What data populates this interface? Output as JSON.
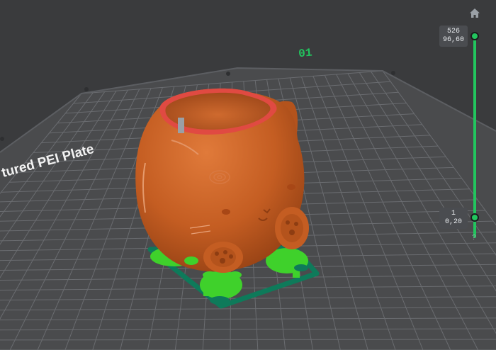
{
  "viewport": {
    "plate_label": "tured PEI Plate",
    "plate_number": "01"
  },
  "layer_slider": {
    "top_layer": "526",
    "top_height": "96,60",
    "bottom_layer": "1",
    "bottom_height": "0,20",
    "help": "?"
  },
  "icons": {
    "home": "home-icon"
  },
  "colors": {
    "background": "#3a3b3d",
    "plate": "#4a4b4d",
    "grid": "#6a6c70",
    "model": "#c45d22",
    "support": "#3fd12b",
    "brim": "#0e7a5a",
    "slider": "#22c55e"
  }
}
